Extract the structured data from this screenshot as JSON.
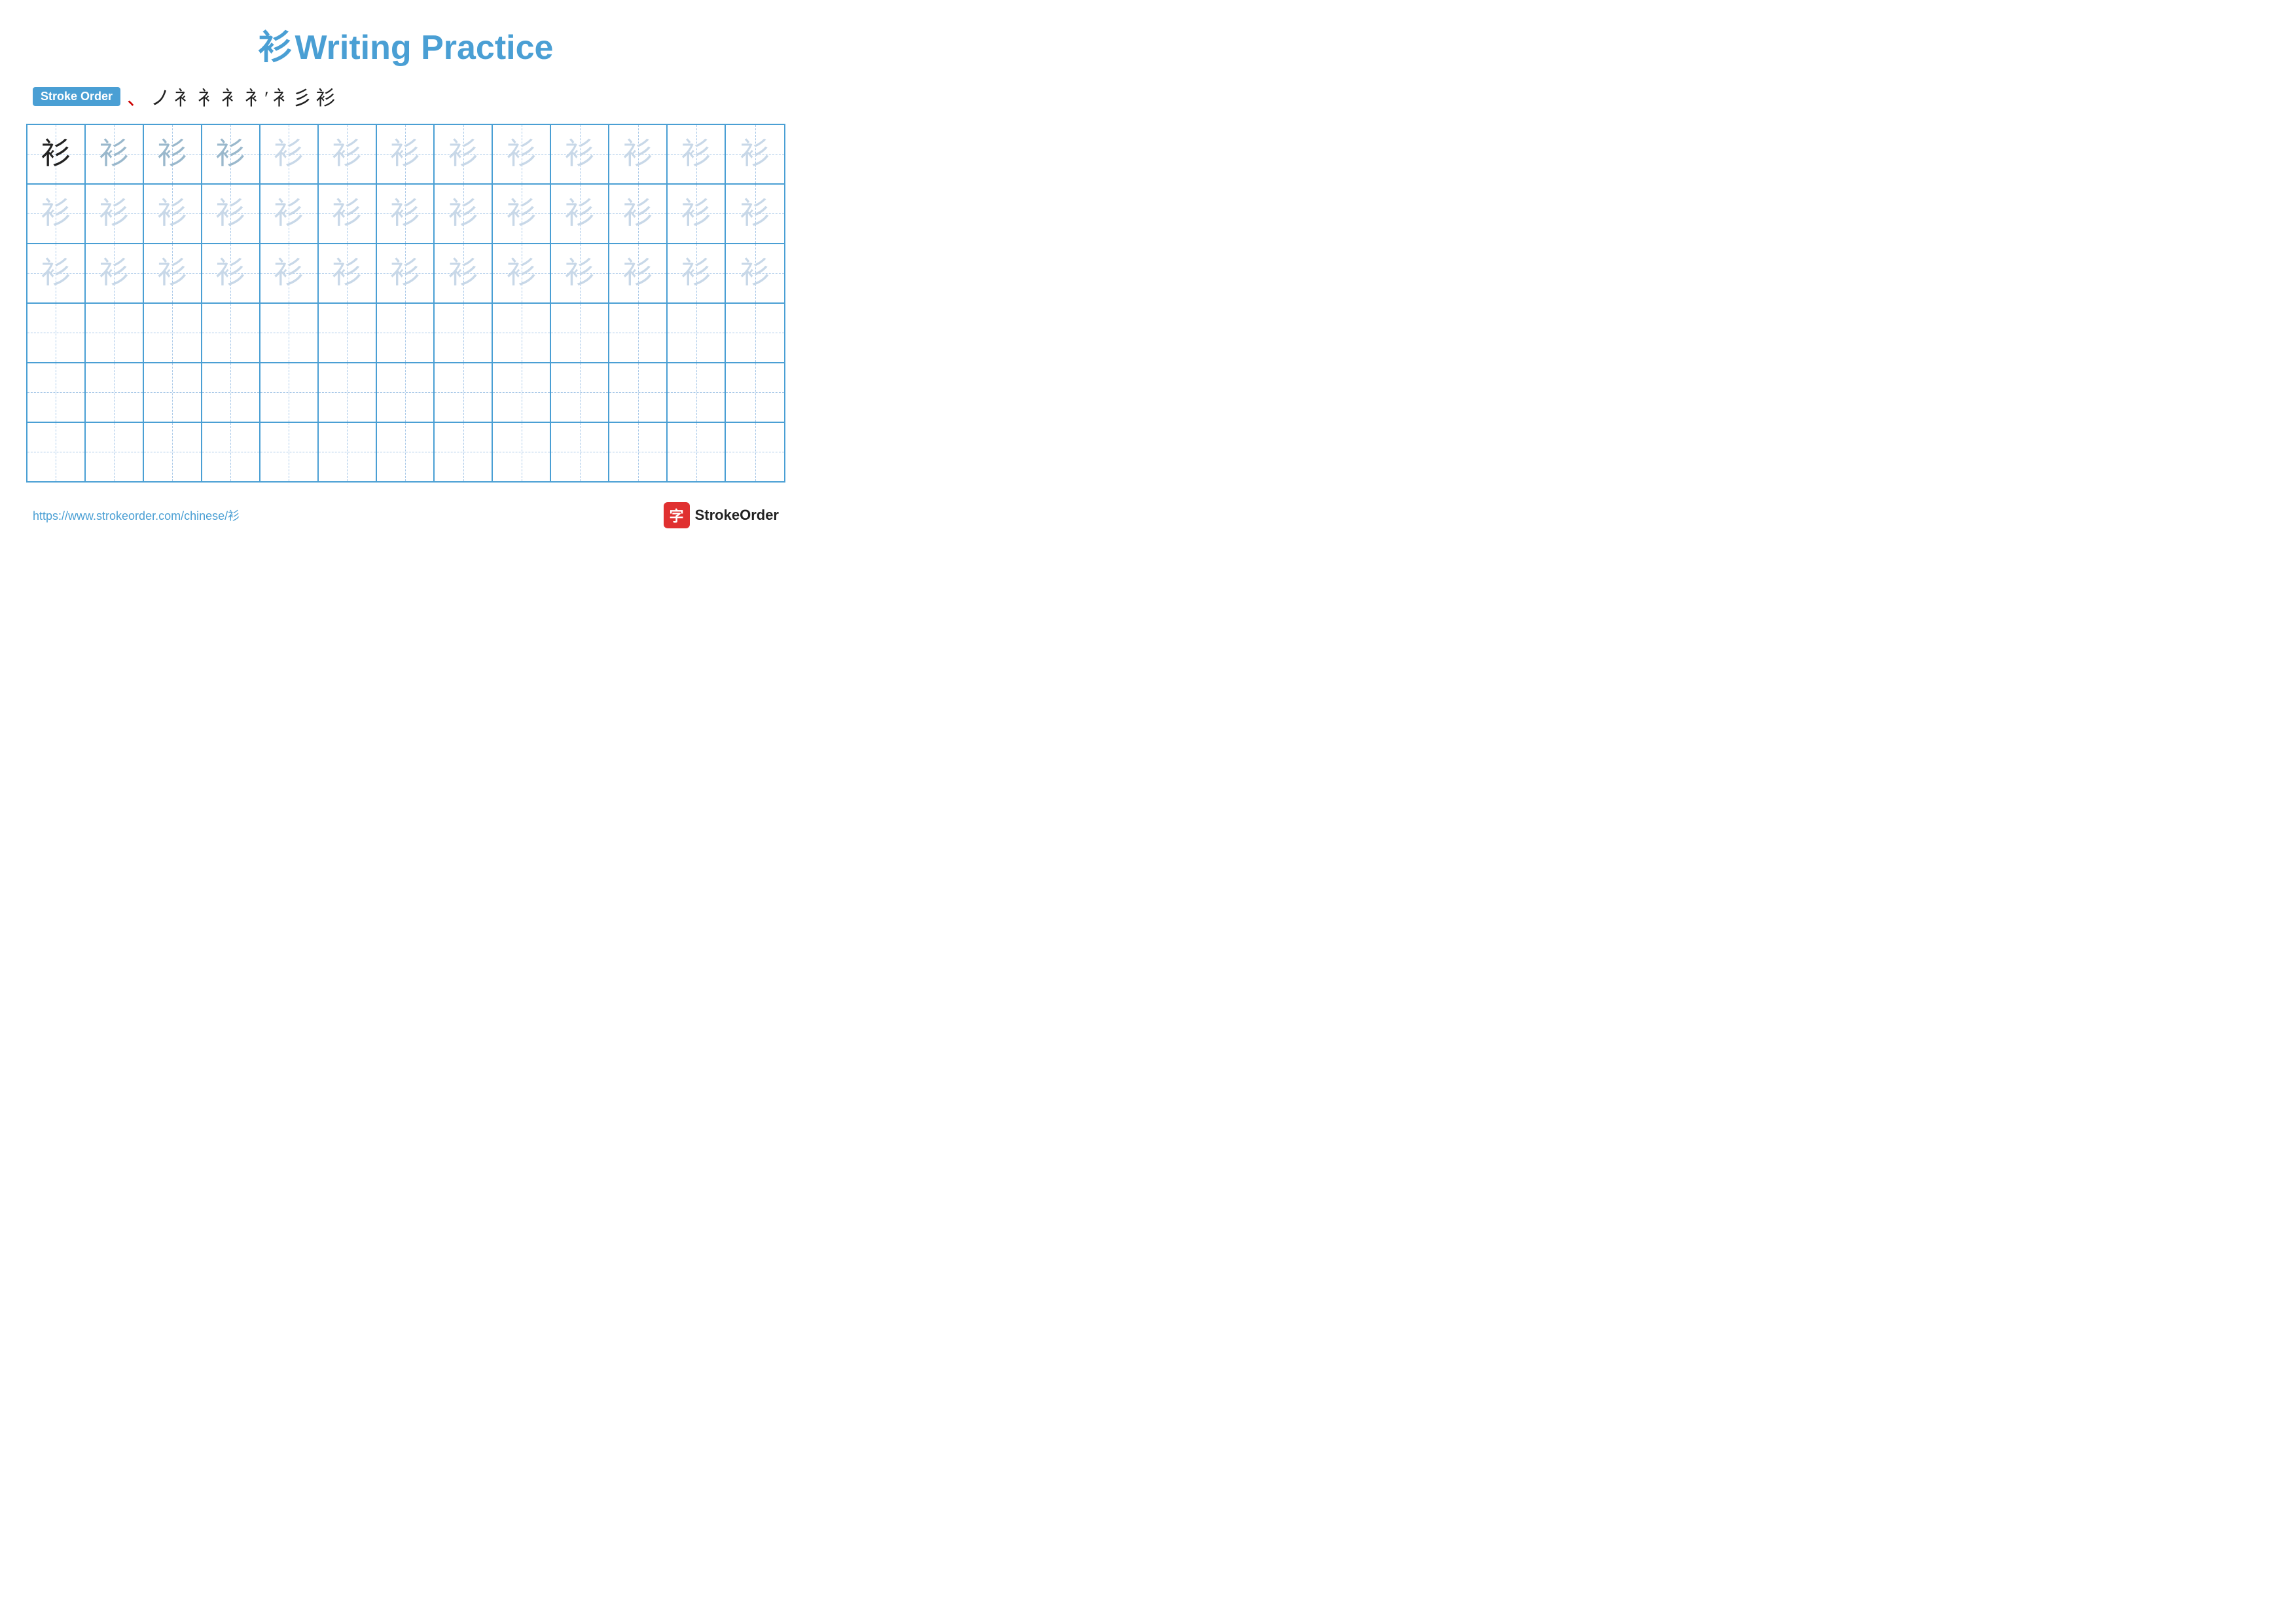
{
  "title": {
    "char": "衫",
    "label": "Writing Practice"
  },
  "stroke_order": {
    "badge": "Stroke Order",
    "steps": [
      "、",
      "ノ",
      "衤",
      "衤",
      "衤",
      "衤′",
      "衤彡",
      "衫"
    ]
  },
  "grid": {
    "rows": 6,
    "cols": 13,
    "char": "衫",
    "row_types": [
      "dark-fading",
      "light",
      "light",
      "empty",
      "empty",
      "empty"
    ]
  },
  "footer": {
    "url": "https://www.strokeorder.com/chinese/衫",
    "logo_icon": "字",
    "logo_text": "StrokeOrder"
  }
}
